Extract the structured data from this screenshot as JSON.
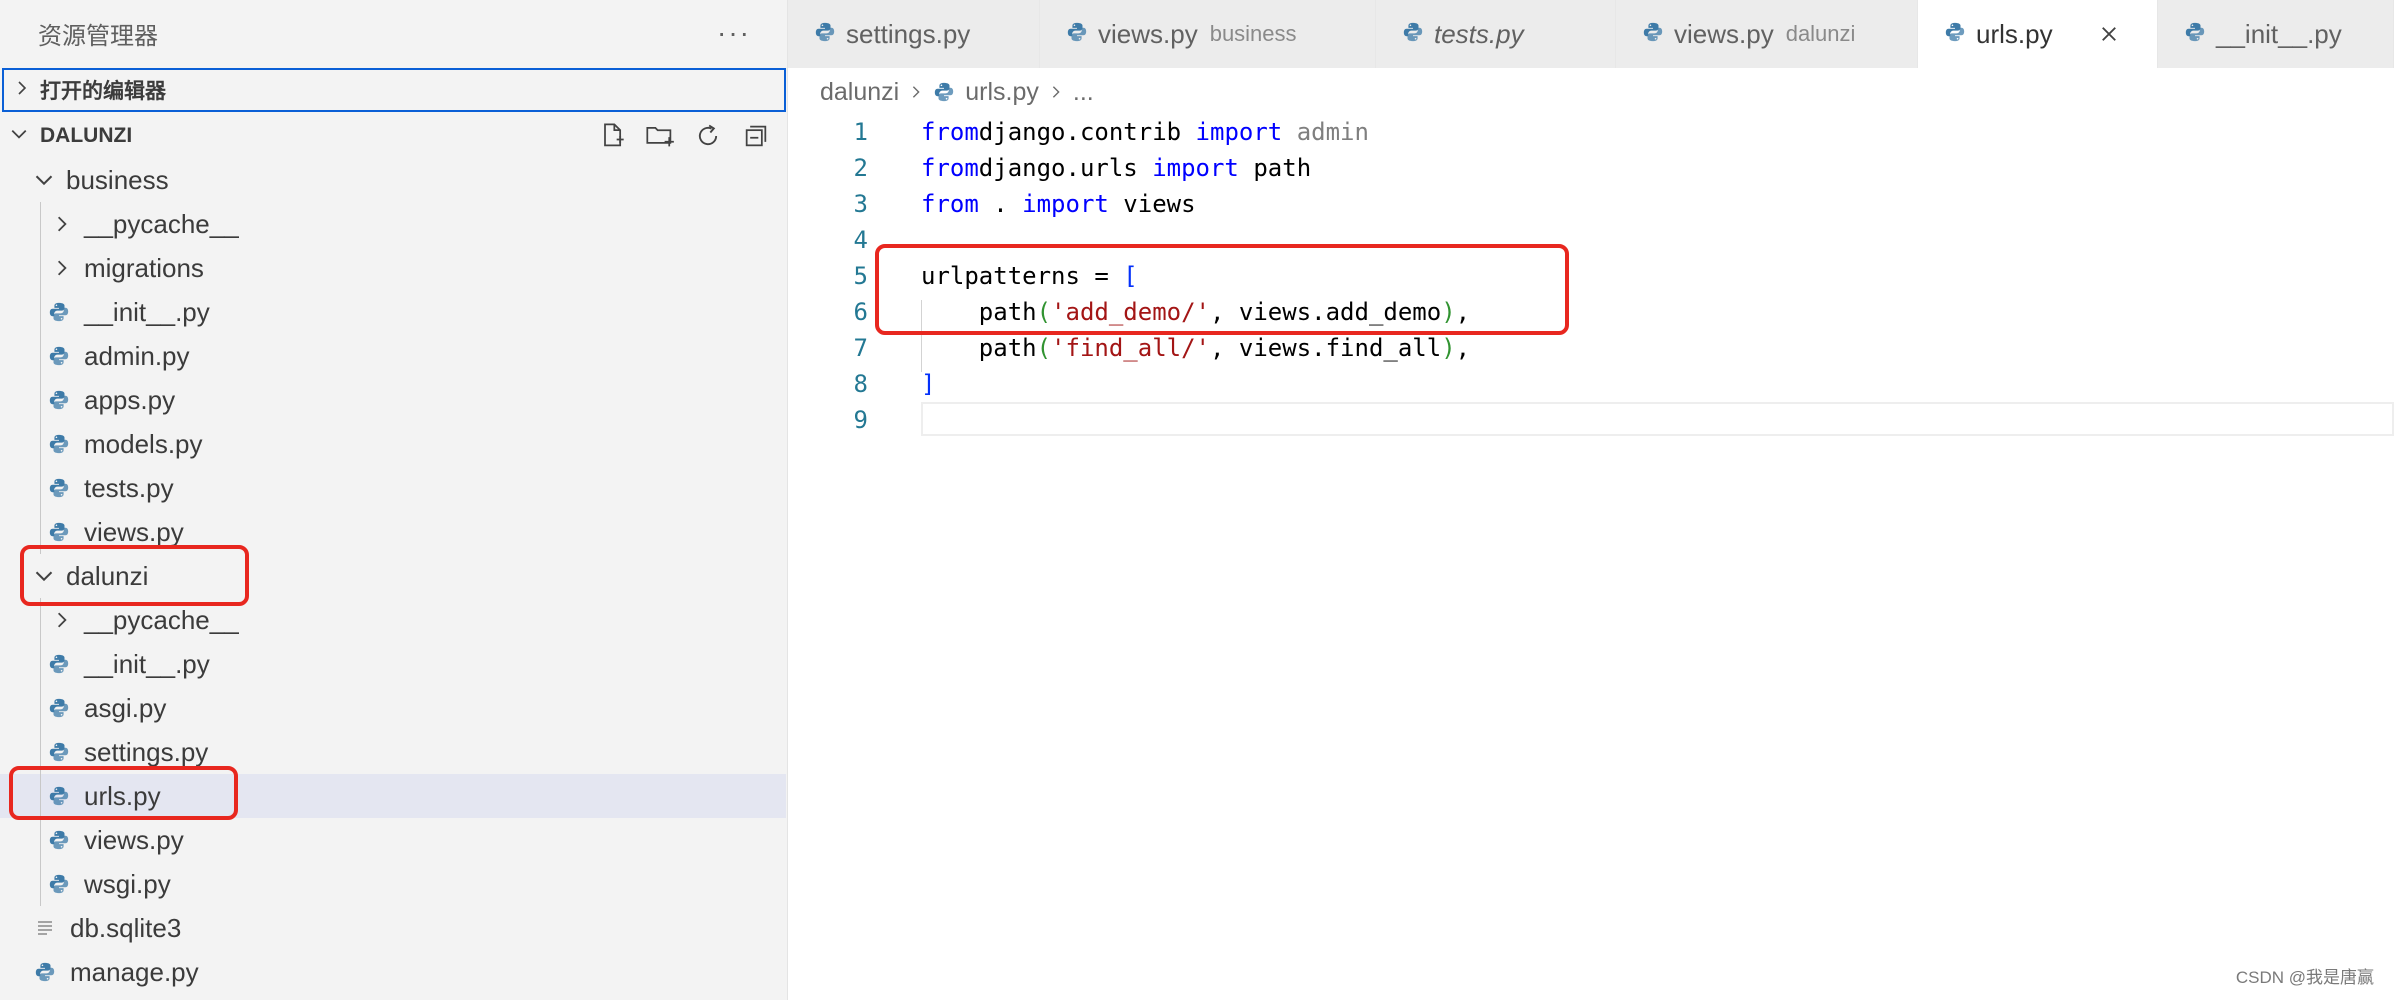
{
  "sidebar": {
    "title": "资源管理器",
    "more": "···",
    "open_editors": "打开的编辑器",
    "root": "DALUNZI",
    "tree": [
      {
        "label": "business",
        "depth": 0,
        "type": "folder",
        "expanded": true
      },
      {
        "label": "__pycache__",
        "depth": 1,
        "type": "folder",
        "expanded": false
      },
      {
        "label": "migrations",
        "depth": 1,
        "type": "folder",
        "expanded": false
      },
      {
        "label": "__init__.py",
        "depth": 1,
        "type": "py"
      },
      {
        "label": "admin.py",
        "depth": 1,
        "type": "py"
      },
      {
        "label": "apps.py",
        "depth": 1,
        "type": "py"
      },
      {
        "label": "models.py",
        "depth": 1,
        "type": "py"
      },
      {
        "label": "tests.py",
        "depth": 1,
        "type": "py"
      },
      {
        "label": "views.py",
        "depth": 1,
        "type": "py"
      },
      {
        "label": "dalunzi",
        "depth": 0,
        "type": "folder",
        "expanded": true
      },
      {
        "label": "__pycache__",
        "depth": 1,
        "type": "folder",
        "expanded": false
      },
      {
        "label": "__init__.py",
        "depth": 1,
        "type": "py"
      },
      {
        "label": "asgi.py",
        "depth": 1,
        "type": "py"
      },
      {
        "label": "settings.py",
        "depth": 1,
        "type": "py"
      },
      {
        "label": "urls.py",
        "depth": 1,
        "type": "py",
        "selected": true
      },
      {
        "label": "views.py",
        "depth": 1,
        "type": "py"
      },
      {
        "label": "wsgi.py",
        "depth": 1,
        "type": "py"
      },
      {
        "label": "db.sqlite3",
        "depth": 0,
        "type": "file"
      },
      {
        "label": "manage.py",
        "depth": 0,
        "type": "py"
      }
    ]
  },
  "tabs": [
    {
      "name": "settings.py",
      "desc": "",
      "italic": false,
      "active": false
    },
    {
      "name": "views.py",
      "desc": "business",
      "italic": false,
      "active": false
    },
    {
      "name": "tests.py",
      "desc": "",
      "italic": true,
      "active": false
    },
    {
      "name": "views.py",
      "desc": "dalunzi",
      "italic": false,
      "active": false
    },
    {
      "name": "urls.py",
      "desc": "",
      "italic": false,
      "active": true
    },
    {
      "name": "__init__.py",
      "desc": "",
      "italic": false,
      "active": false
    }
  ],
  "breadcrumb": {
    "folder": "dalunzi",
    "file": "urls.py",
    "more": "..."
  },
  "editor": {
    "line_numbers": [
      "1",
      "2",
      "3",
      "4",
      "5",
      "6",
      "7",
      "8",
      "9"
    ],
    "lines": [
      [
        [
          "kw",
          "from"
        ],
        [
          "",
          "django.contrib "
        ],
        [
          "kw",
          "import"
        ],
        [
          "dim",
          " admin"
        ]
      ],
      [
        [
          "kw",
          "from"
        ],
        [
          "",
          "django.urls "
        ],
        [
          "kw",
          "import"
        ],
        [
          "",
          " path"
        ]
      ],
      [
        [
          "kw",
          "from"
        ],
        [
          "",
          " . "
        ],
        [
          "kw",
          "import"
        ],
        [
          "",
          " views"
        ]
      ],
      [],
      [
        [
          "",
          "urlpatterns = "
        ],
        [
          "br1",
          "["
        ]
      ],
      [
        [
          "",
          "    path"
        ],
        [
          "br2",
          "("
        ],
        [
          "str",
          "'add_demo/'"
        ],
        [
          "",
          ", views.add_demo"
        ],
        [
          "br2",
          ")"
        ],
        [
          "",
          ","
        ]
      ],
      [
        [
          "",
          "    path"
        ],
        [
          "br2",
          "("
        ],
        [
          "str",
          "'find_all/'"
        ],
        [
          "",
          ", views.find_all"
        ],
        [
          "br2",
          ")"
        ],
        [
          "",
          ","
        ]
      ],
      [
        [
          "br1",
          "]"
        ]
      ],
      []
    ]
  },
  "colors": {
    "accent": "#0a5fd6",
    "annotation": "#e8271f",
    "selection": "#e4e6f1"
  },
  "watermark": "CSDN @我是唐赢"
}
